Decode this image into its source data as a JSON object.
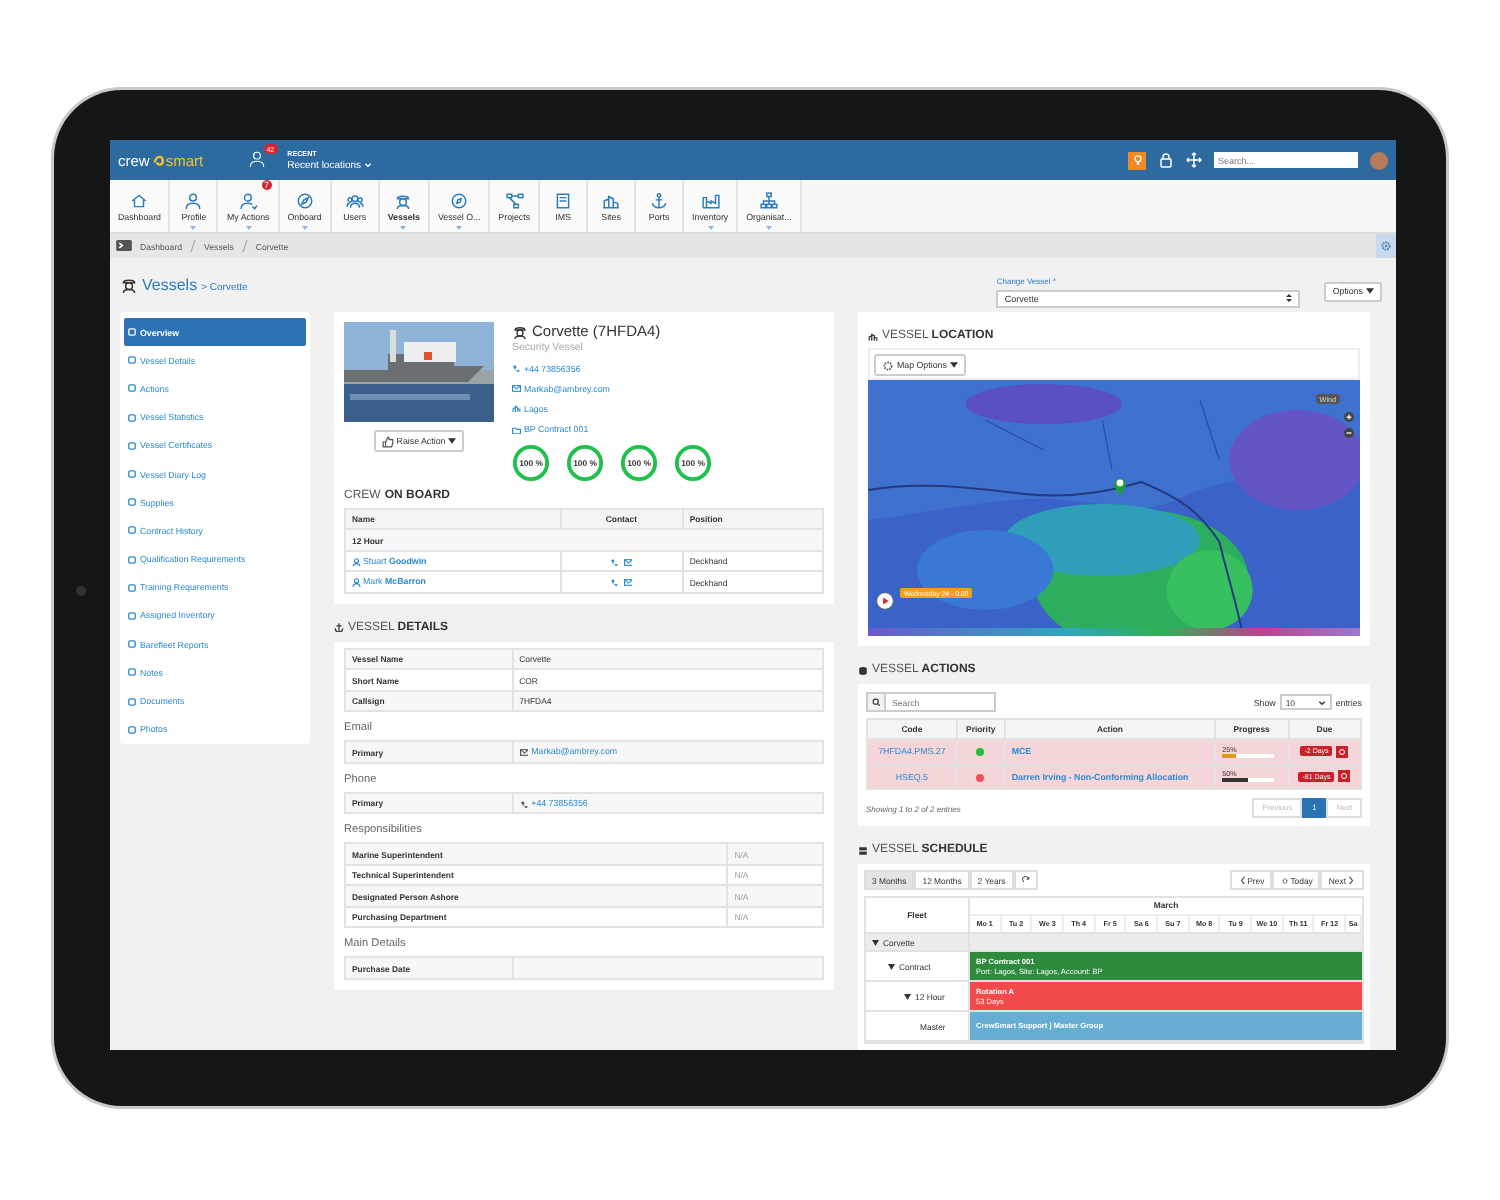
{
  "topbar": {
    "logo_left": "crew",
    "logo_right": "smart",
    "notification_count": "42",
    "recent_label": "RECENT",
    "recent_value": "Recent locations",
    "search": {
      "placeholder": "Search..."
    }
  },
  "nav": [
    {
      "label": "Dashboard",
      "selected": false,
      "dropdown": false
    },
    {
      "label": "Profile",
      "selected": false,
      "dropdown": true
    },
    {
      "label": "My Actions",
      "selected": false,
      "dropdown": true,
      "badge": "7"
    },
    {
      "label": "Onboard",
      "selected": false,
      "dropdown": true
    },
    {
      "label": "Users",
      "selected": false,
      "dropdown": false
    },
    {
      "label": "Vessels",
      "selected": true,
      "dropdown": true
    },
    {
      "label": "Vessel O...",
      "selected": false,
      "dropdown": true
    },
    {
      "label": "Projects",
      "selected": false,
      "dropdown": false
    },
    {
      "label": "IMS",
      "selected": false,
      "dropdown": false
    },
    {
      "label": "Sites",
      "selected": false,
      "dropdown": false
    },
    {
      "label": "Ports",
      "selected": false,
      "dropdown": false
    },
    {
      "label": "Inventory",
      "selected": false,
      "dropdown": true
    },
    {
      "label": "Organisat...",
      "selected": false,
      "dropdown": true
    }
  ],
  "breadcrumb": [
    "Dashboard",
    "Vessels",
    "Corvette"
  ],
  "page_header": {
    "title": "Vessels",
    "subtitle": "> Corvette",
    "change_vessel_label": "Change Vessel *",
    "vessel_select": "Corvette",
    "options_button": "Options"
  },
  "sidebar": [
    {
      "label": "Overview",
      "selected": true
    },
    {
      "label": "Vessel Details",
      "selected": false
    },
    {
      "label": "Actions",
      "selected": false
    },
    {
      "label": "Vessel Statistics",
      "selected": false
    },
    {
      "label": "Vessel Certificates",
      "selected": false
    },
    {
      "label": "Vessel Diary Log",
      "selected": false
    },
    {
      "label": "Supplies",
      "selected": false
    },
    {
      "label": "Contract History",
      "selected": false
    },
    {
      "label": "Qualification Requirements",
      "selected": false
    },
    {
      "label": "Training Requirements",
      "selected": false
    },
    {
      "label": "Assigned Inventory",
      "selected": false
    },
    {
      "label": "Barefleet Reports",
      "selected": false
    },
    {
      "label": "Notes",
      "selected": false
    },
    {
      "label": "Documents",
      "selected": false
    },
    {
      "label": "Photos",
      "selected": false
    }
  ],
  "overview": {
    "name": "Corvette (7HFDA4)",
    "type": "Security Vessel",
    "phone": "+44 73856356",
    "email": "Markab@ambrey.com",
    "location": "Lagos",
    "contract": "BP Contract 001",
    "raise_action": "Raise Action",
    "gauges": [
      {
        "text": "100 %",
        "level": 1
      },
      {
        "text": "100 %",
        "level": 1
      },
      {
        "text": "100 %",
        "level": 1
      },
      {
        "text": "100 %",
        "level": 1
      }
    ]
  },
  "crew": {
    "title": "CREW **ON BOARD**",
    "columns": [
      "Name",
      "Contact",
      "Position"
    ],
    "group": "12 Hour",
    "rows": [
      {
        "name": "Stuart **Goodwin**",
        "position": "Deckhand"
      },
      {
        "name": "Mark **McBarron**",
        "position": "Deckhand"
      }
    ]
  },
  "vessel_details": {
    "title": "VESSEL **DETAILS**",
    "groups": [
      {
        "kind": "kv",
        "rows": [
          {
            "label": "Vessel Name",
            "value": "Corvette",
            "kind": "text"
          },
          {
            "label": "Short Name",
            "value": "COR",
            "kind": "text"
          },
          {
            "label": "Callsign",
            "value": "7HFDA4",
            "kind": "text"
          }
        ]
      },
      {
        "kind": "kv",
        "heading": "Email",
        "rows": [
          {
            "label": "Primary",
            "value": "Markab@ambrey.com",
            "kind": "email"
          }
        ]
      },
      {
        "kind": "kv",
        "heading": "Phone",
        "rows": [
          {
            "label": "Primary",
            "value": "+44 73856356",
            "kind": "phone"
          }
        ]
      },
      {
        "kind": "roles",
        "heading": "Responsibilities",
        "rows": [
          {
            "label": "Marine Superintendent",
            "value": "N/A",
            "kind": "text"
          },
          {
            "label": "Technical Superintendent",
            "value": "N/A",
            "kind": "text"
          },
          {
            "label": "Designated Person Ashore",
            "value": "N/A",
            "kind": "text"
          },
          {
            "label": "Purchasing Department",
            "value": "N/A",
            "kind": "text"
          }
        ]
      },
      {
        "kind": "kv",
        "heading": "Main Details",
        "rows": [
          {
            "label": "Purchase Date",
            "kind": "text"
          }
        ]
      }
    ]
  },
  "location": {
    "title": "VESSEL **LOCATION**",
    "map_options": "Map Options",
    "layer": "Wind",
    "date_label": "Wednesday 24 - 0:00"
  },
  "actions": {
    "title": "VESSEL **ACTIONS**",
    "search": {
      "placeholder": "Search"
    },
    "show": "Show",
    "page_size": "10",
    "entries": "entries",
    "columns": [
      "Code",
      "Priority",
      "Action",
      "Progress",
      "Due"
    ],
    "rows": [
      {
        "code": "7HFDA4.PMS.27",
        "priority": {
          "color": "#22bb33"
        },
        "action": "MCE",
        "progress": {
          "text": "25%",
          "level": 0.25,
          "color": "#d99a1e"
        },
        "due": "-2 Days"
      },
      {
        "code": "HSEQ.5",
        "priority": {
          "color": "#f04e5a"
        },
        "action": "Darren Irving - Non-Conforming Allocation",
        "progress": {
          "text": "50%",
          "level": 0.5,
          "color": "#333333"
        },
        "due": "-81 Days"
      }
    ],
    "info": "Showing 1 to 2 of 2 entries",
    "pagination": [
      {
        "label": "Previous",
        "selected": false
      },
      {
        "label": "1",
        "selected": true
      },
      {
        "label": "Next",
        "selected": false
      }
    ]
  },
  "schedule": {
    "title": "VESSEL **SCHEDULE**",
    "ranges": [
      {
        "label": "3 Months",
        "selected": true
      },
      {
        "label": "12 Months",
        "selected": false
      },
      {
        "label": "2 Years",
        "selected": false
      }
    ],
    "prev": "Prev",
    "today": "Today",
    "next": "Next",
    "fleet_label": "Fleet",
    "month": "March",
    "days": [
      "Mo 1",
      "Tu 2",
      "We 3",
      "Th 4",
      "Fr 5",
      "Sa 6",
      "Su 7",
      "Mo 8",
      "Tu 9",
      "We 10",
      "Th 11",
      "Fr 12",
      "Sa"
    ],
    "tree": [
      {
        "label": "Corvette",
        "expanded": true,
        "children": [
          {
            "label": "Contract",
            "expanded": true,
            "bar": {
              "title": "BP Contract 001",
              "detail": "Port: Lagos, Site: Lagos, Account: BP",
              "color": "#2e8b3e"
            },
            "children": [
              {
                "label": "12 Hour",
                "expanded": true,
                "bar": {
                  "title": "Rotation A",
                  "detail": "53 Days",
                  "color": "#f24a4a"
                },
                "children": [
                  {
                    "label": "Master",
                    "bar": {
                      "title": "CrewSmart Support | Master Group",
                      "color": "#66aed3"
                    }
                  }
                ]
              }
            ]
          }
        ]
      }
    ]
  }
}
